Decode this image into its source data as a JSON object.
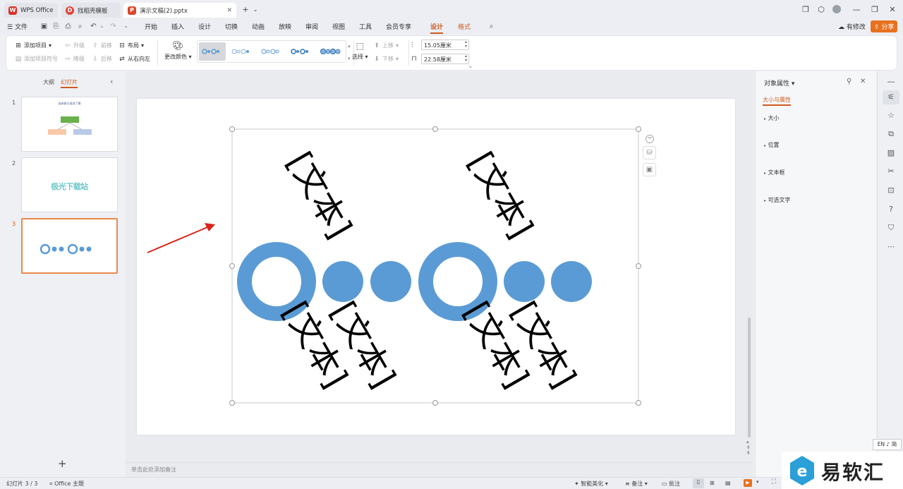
{
  "titlebar": {
    "tabs": [
      {
        "label": "WPS Office",
        "color": "#d9312a"
      },
      {
        "label": "找稻壳模板",
        "color": "#e0453b"
      },
      {
        "label": "演示文稿(2).pptx",
        "color": "#d9482b"
      }
    ]
  },
  "menubar": {
    "file": "文件",
    "items": [
      "开始",
      "插入",
      "设计",
      "切换",
      "动画",
      "放映",
      "审阅",
      "视图",
      "工具",
      "会员专享",
      "设计",
      "格式"
    ],
    "active_item": "设计",
    "edit_status": "有修改",
    "share": "分享"
  },
  "ribbon": {
    "add_item": "添加项目",
    "add_bullet": "添加项目符号",
    "promote": "升级",
    "demote": "降级",
    "move_forward": "前移",
    "move_back": "后移",
    "layout": "布局",
    "rtl": "从右向左",
    "change_color": "更改颜色",
    "select": "选择",
    "move_up": "上移",
    "move_down": "下移",
    "height": "15.05厘米",
    "width": "22.58厘米"
  },
  "leftpanel": {
    "tab_outline": "大纲",
    "tab_slides": "幻灯片",
    "slides": [
      "1",
      "2",
      "3"
    ],
    "slide1_title": "谁来做主谁说了算",
    "slide2_text": "极光下载站"
  },
  "slide": {
    "text_placeholder": "[文本]"
  },
  "notes": {
    "placeholder": "单击此处添加备注"
  },
  "rightpanel": {
    "title": "对象属性",
    "subtab": "大小与属性",
    "sections": [
      "大小",
      "位置",
      "文本框",
      "可选文字"
    ]
  },
  "statusbar": {
    "slide_count": "幻灯片 3 / 3",
    "theme": "Office 主题",
    "smart_beautify": "智能美化",
    "notes": "备注",
    "comments": "批注"
  },
  "ime": "EN ♪ 简",
  "watermark": "易软汇",
  "colors": {
    "accent": "#d05a1e",
    "smartart_blue": "#5b9bd5",
    "arrow_red": "#d9251c"
  }
}
